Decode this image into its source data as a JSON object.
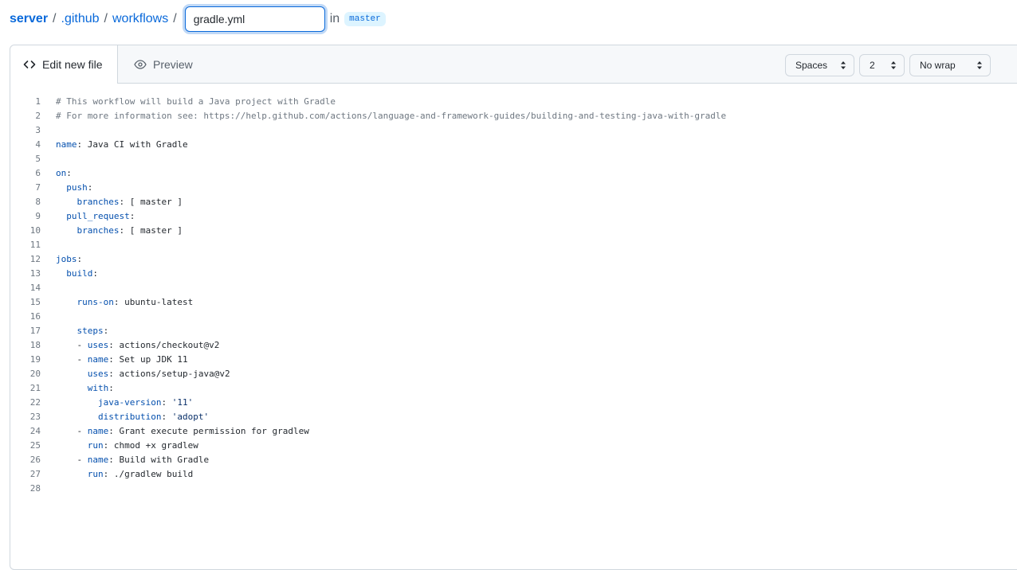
{
  "breadcrumb": {
    "repo": "server",
    "sep": "/",
    "folder1": ".github",
    "folder2": "workflows",
    "filename_value": "gradle.yml",
    "in_label": "in",
    "branch": "master"
  },
  "tabs": {
    "edit": "Edit new file",
    "preview": "Preview"
  },
  "options": {
    "indent_mode": "Spaces",
    "indent_size": "2",
    "wrap_mode": "No wrap"
  },
  "code_lines": [
    [
      [
        "c",
        "# This workflow will build a Java project with Gradle"
      ]
    ],
    [
      [
        "c",
        "# For more information see: https://help.github.com/actions/language-and-framework-guides/building-and-testing-java-with-gradle"
      ]
    ],
    [],
    [
      [
        "key",
        "name"
      ],
      [
        "p",
        ": Java CI with Gradle"
      ]
    ],
    [],
    [
      [
        "key",
        "on"
      ],
      [
        "p",
        ":"
      ]
    ],
    [
      [
        "p",
        "  "
      ],
      [
        "key",
        "push"
      ],
      [
        "p",
        ":"
      ]
    ],
    [
      [
        "p",
        "    "
      ],
      [
        "key",
        "branches"
      ],
      [
        "p",
        ": [ master ]"
      ]
    ],
    [
      [
        "p",
        "  "
      ],
      [
        "key",
        "pull_request"
      ],
      [
        "p",
        ":"
      ]
    ],
    [
      [
        "p",
        "    "
      ],
      [
        "key",
        "branches"
      ],
      [
        "p",
        ": [ master ]"
      ]
    ],
    [],
    [
      [
        "key",
        "jobs"
      ],
      [
        "p",
        ":"
      ]
    ],
    [
      [
        "p",
        "  "
      ],
      [
        "key",
        "build"
      ],
      [
        "p",
        ":"
      ]
    ],
    [],
    [
      [
        "p",
        "    "
      ],
      [
        "key",
        "runs-on"
      ],
      [
        "p",
        ": ubuntu-latest"
      ]
    ],
    [],
    [
      [
        "p",
        "    "
      ],
      [
        "key",
        "steps"
      ],
      [
        "p",
        ":"
      ]
    ],
    [
      [
        "p",
        "    - "
      ],
      [
        "key",
        "uses"
      ],
      [
        "p",
        ": actions/checkout@v2"
      ]
    ],
    [
      [
        "p",
        "    - "
      ],
      [
        "key",
        "name"
      ],
      [
        "p",
        ": Set up JDK 11"
      ]
    ],
    [
      [
        "p",
        "      "
      ],
      [
        "key",
        "uses"
      ],
      [
        "p",
        ": actions/setup-java@v2"
      ]
    ],
    [
      [
        "p",
        "      "
      ],
      [
        "key",
        "with"
      ],
      [
        "p",
        ":"
      ]
    ],
    [
      [
        "p",
        "        "
      ],
      [
        "key",
        "java-version"
      ],
      [
        "p",
        ": "
      ],
      [
        "s",
        "'11'"
      ]
    ],
    [
      [
        "p",
        "        "
      ],
      [
        "key",
        "distribution"
      ],
      [
        "p",
        ": "
      ],
      [
        "s",
        "'adopt'"
      ]
    ],
    [
      [
        "p",
        "    - "
      ],
      [
        "key",
        "name"
      ],
      [
        "p",
        ": Grant execute permission for gradlew"
      ]
    ],
    [
      [
        "p",
        "      "
      ],
      [
        "key",
        "run"
      ],
      [
        "p",
        ": chmod +x gradlew"
      ]
    ],
    [
      [
        "p",
        "    - "
      ],
      [
        "key",
        "name"
      ],
      [
        "p",
        ": Build with Gradle"
      ]
    ],
    [
      [
        "p",
        "      "
      ],
      [
        "key",
        "run"
      ],
      [
        "p",
        ": ./gradlew build"
      ]
    ],
    []
  ]
}
